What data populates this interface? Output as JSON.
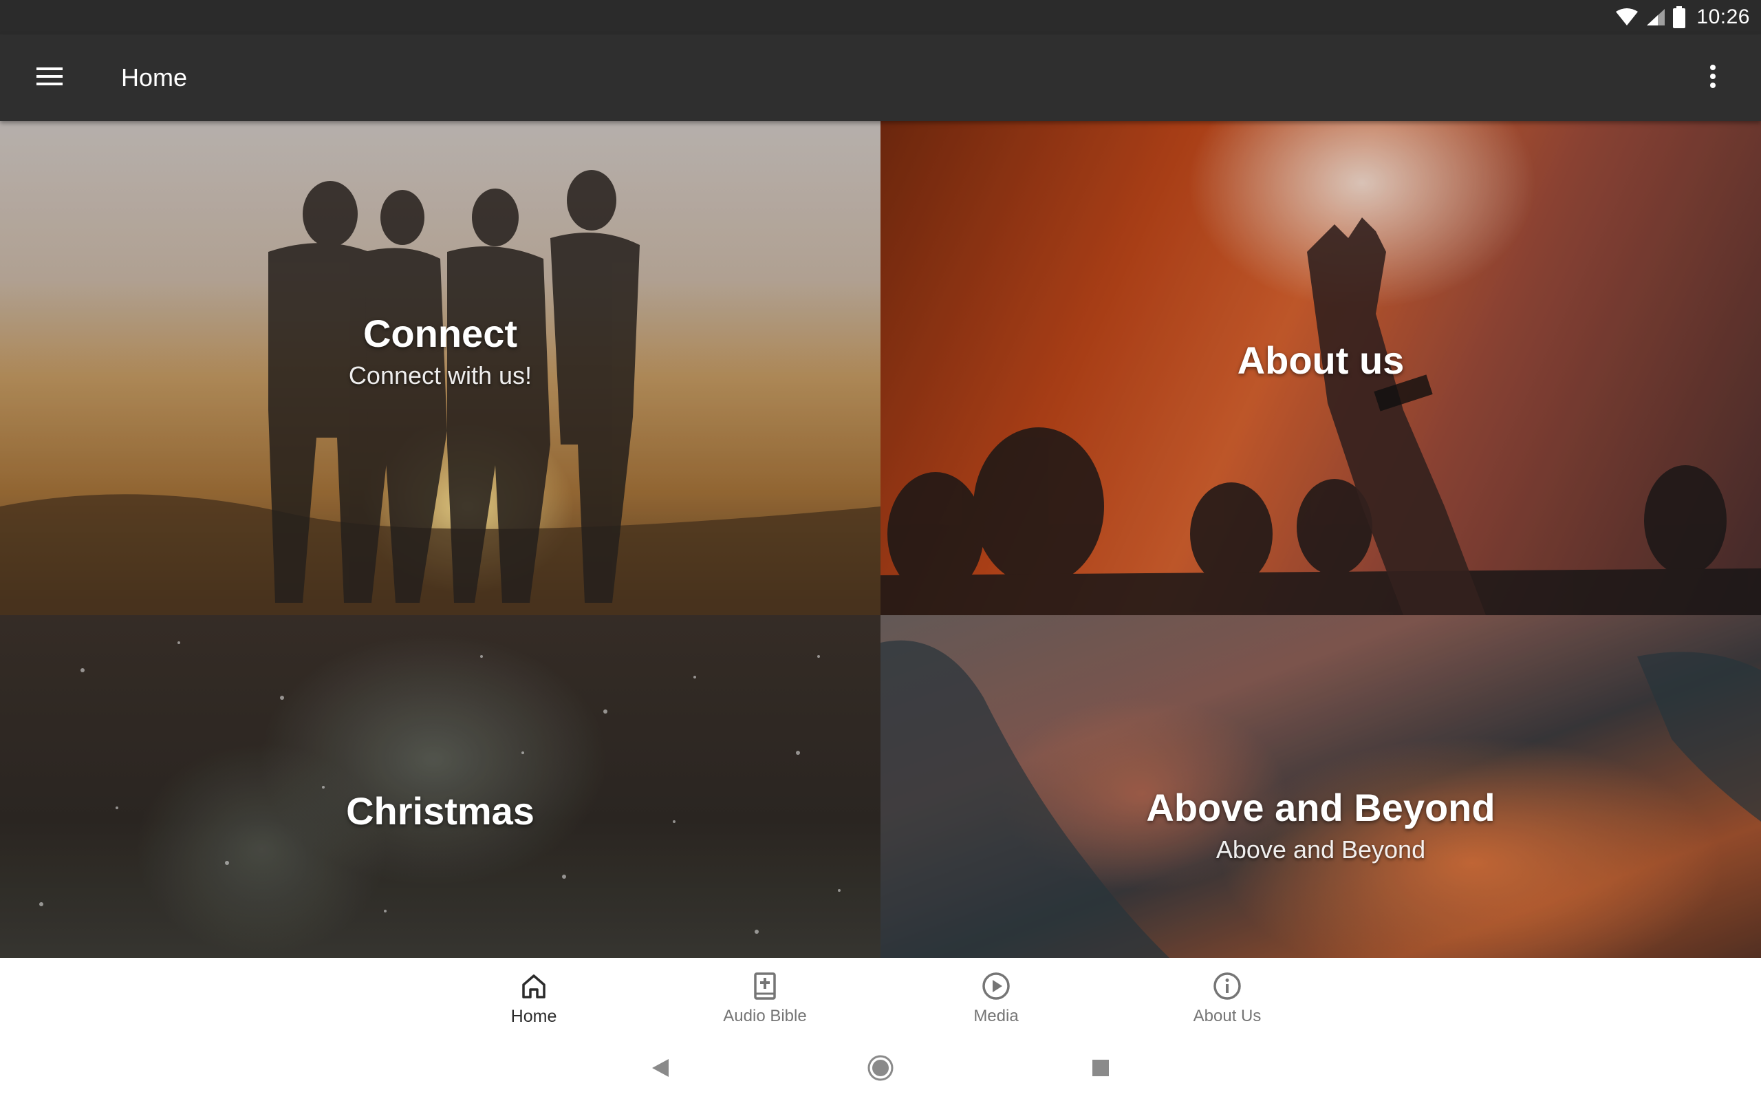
{
  "status_bar": {
    "time": "10:26",
    "icons": [
      "wifi-icon",
      "signal-icon",
      "battery-icon"
    ]
  },
  "app_bar": {
    "title": "Home",
    "menu_icon": "hamburger-menu-icon",
    "overflow_icon": "more-vertical-icon"
  },
  "tiles": [
    {
      "title": "Connect",
      "subtitle": "Connect with us!"
    },
    {
      "title": "About us",
      "subtitle": ""
    },
    {
      "title": "Christmas",
      "subtitle": ""
    },
    {
      "title": "Above and Beyond",
      "subtitle": "Above and Beyond"
    }
  ],
  "bottom_nav": {
    "active_index": 0,
    "items": [
      {
        "label": "Home",
        "icon": "home-icon"
      },
      {
        "label": "Audio Bible",
        "icon": "bible-icon"
      },
      {
        "label": "Media",
        "icon": "play-circle-icon"
      },
      {
        "label": "About Us",
        "icon": "info-icon"
      }
    ]
  },
  "system_nav": [
    "back-icon",
    "home-circle-icon",
    "recents-icon"
  ],
  "colors": {
    "status_bar": "#2b2b2b",
    "app_bar": "#2f2f2f",
    "nav_active": "#2b2b2b",
    "nav_inactive": "#757575"
  }
}
